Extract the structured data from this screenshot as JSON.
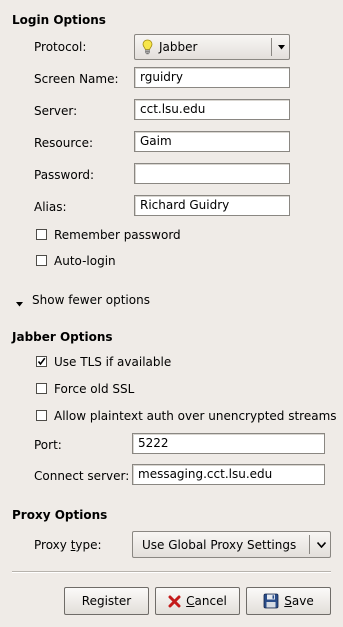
{
  "login_options": {
    "title": "Login Options",
    "protocol": {
      "label": "Protocol:",
      "value": "Jabber",
      "icon": "lightbulb-icon"
    },
    "screen_name": {
      "label": "Screen Name:",
      "value": "rguidry"
    },
    "server": {
      "label": "Server:",
      "value": "cct.lsu.edu"
    },
    "resource": {
      "label": "Resource:",
      "value": "Gaim"
    },
    "password": {
      "label": "Password:",
      "value": ""
    },
    "alias": {
      "label": "Alias:",
      "value": "Richard Guidry"
    },
    "remember_password": {
      "label": "Remember password",
      "checked": false
    },
    "auto_login": {
      "label": "Auto-login",
      "checked": false
    }
  },
  "expander": {
    "label": "Show fewer options",
    "expanded": true
  },
  "jabber_options": {
    "title": "Jabber Options",
    "use_tls": {
      "label": "Use TLS if available",
      "checked": true
    },
    "force_old_ssl": {
      "label": "Force old SSL",
      "checked": false
    },
    "allow_plaintext": {
      "label": "Allow plaintext auth over unencrypted streams",
      "checked": false
    },
    "port": {
      "label": "Port:",
      "value": "5222"
    },
    "connect_server": {
      "label": "Connect server:",
      "value": "messaging.cct.lsu.edu"
    }
  },
  "proxy_options": {
    "title": "Proxy Options",
    "proxy_type": {
      "label_pre": "Proxy ",
      "label_mnemonic": "t",
      "label_post": "ype:",
      "value": "Use Global Proxy Settings"
    }
  },
  "buttons": {
    "register": "Register",
    "cancel_mnemonic": "C",
    "cancel_rest": "ancel",
    "save_mnemonic": "S",
    "save_rest": "ave"
  },
  "colors": {
    "window_bg": "#efebe7",
    "cancel_icon": "#c41a1a",
    "save_icon": "#2a4d8a"
  }
}
